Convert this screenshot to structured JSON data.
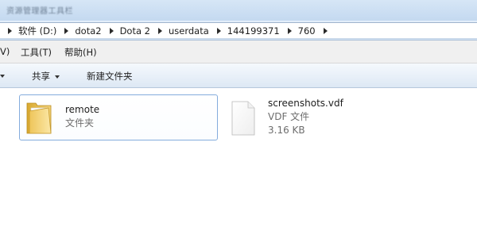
{
  "window": {
    "title": "资源管理器工具栏"
  },
  "address": {
    "crumbs": [
      "软件 (D:)",
      "dota2",
      "Dota 2",
      "userdata",
      "144199371",
      "760"
    ]
  },
  "menu": {
    "view_partial": "V)",
    "tools": "工具(T)",
    "help": "帮助(H)"
  },
  "toolbar": {
    "share": "共享",
    "new_folder": "新建文件夹"
  },
  "items": [
    {
      "name": "remote",
      "type": "文件夹",
      "icon": "folder-icon",
      "selected": true
    },
    {
      "name": "screenshots.vdf",
      "type": "VDF 文件",
      "size": "3.16 KB",
      "icon": "file-icon",
      "selected": false
    }
  ]
}
